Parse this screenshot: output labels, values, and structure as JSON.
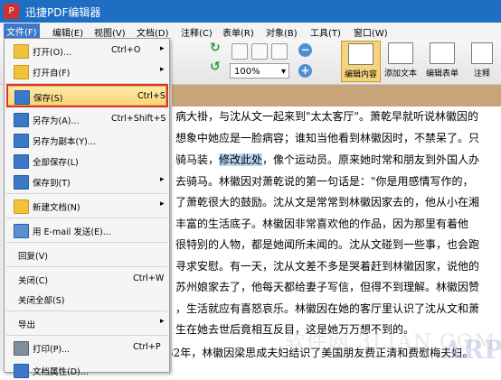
{
  "app": {
    "title": "迅捷PDF编辑器",
    "logo_text": "P"
  },
  "menubar": [
    "文件(F)",
    "编辑(E)",
    "视图(V)",
    "文档(D)",
    "注释(C)",
    "表单(R)",
    "对象(B)",
    "工具(T)",
    "窗口(W)"
  ],
  "toolbar": {
    "zoom_value": "100%",
    "buttons": [
      "编辑内容",
      "添加文本",
      "编辑表单",
      "注释"
    ]
  },
  "file_menu": {
    "items": [
      {
        "label": "打开(O)...",
        "shortcut": "Ctrl+O",
        "submenu": true
      },
      {
        "label": "打开自(F)",
        "shortcut": "",
        "submenu": true
      },
      {
        "label": "保存(S)",
        "shortcut": "Ctrl+S",
        "submenu": false
      },
      {
        "label": "另存为(A)...",
        "shortcut": "Ctrl+Shift+S",
        "submenu": false
      },
      {
        "label": "另存为副本(Y)...",
        "shortcut": "",
        "submenu": false
      },
      {
        "label": "全部保存(L)",
        "shortcut": "",
        "submenu": false
      },
      {
        "label": "保存到(T)",
        "shortcut": "",
        "submenu": true
      },
      {
        "label": "新建文档(N)",
        "shortcut": "",
        "submenu": true
      },
      {
        "label": "用 E-mail 发送(E)...",
        "shortcut": "",
        "submenu": false
      },
      {
        "label": "回复(V)",
        "shortcut": "",
        "submenu": false
      },
      {
        "label": "关闭(C)",
        "shortcut": "Ctrl+W",
        "submenu": false
      },
      {
        "label": "关闭全部(S)",
        "shortcut": "",
        "submenu": false
      },
      {
        "label": "导出",
        "shortcut": "",
        "submenu": true
      },
      {
        "label": "打印(P)...",
        "shortcut": "Ctrl+P",
        "submenu": false
      },
      {
        "label": "文档属性(D)...",
        "shortcut": "",
        "submenu": false
      }
    ]
  },
  "document": {
    "lines": [
      "病大褂，与沈从文一起来到\"太太客厅\"。萧乾早就听说林徽因的",
      "想象中她应是一脸病容；谁知当他看到林徽因时，不禁呆了。只",
      "骑马装，",
      "去骑马。林徽因对萧乾说的第一句话是：\"你是用感情写作的，",
      "了萧乾很大的鼓励。沈从文是常常到林徽因家去的，他从小在湘",
      "丰富的生活底子。林徽因非常喜欢他的作品，因为那里有着他",
      "很特别的人物，都是她闻所未闻的。沈从文碰到一些事，也会跑",
      "寻求安慰。有一天，沈从文差不多是哭着赶到林徽因家，说他的",
      "苏州娘家去了，他每天都给妻子写信，但得不到理解。林徽因赞",
      "，生活就应有喜怒哀乐。林徽因在她的客厅里认识了沈从文和萧",
      "生在她去世后竟相互反目，这是她万万想不到的。",
      "32年，林徽因梁思成夫妇结识了美国朋友费正清和费慰梅夫妇。"
    ],
    "line3_highlight": "修改此处",
    "line3_tail": "，像个运动员。原来她时常和朋友到外国人办",
    "watermark1": "软件网 3LIAN.COM",
    "watermark2": "ARPUN.COM"
  }
}
